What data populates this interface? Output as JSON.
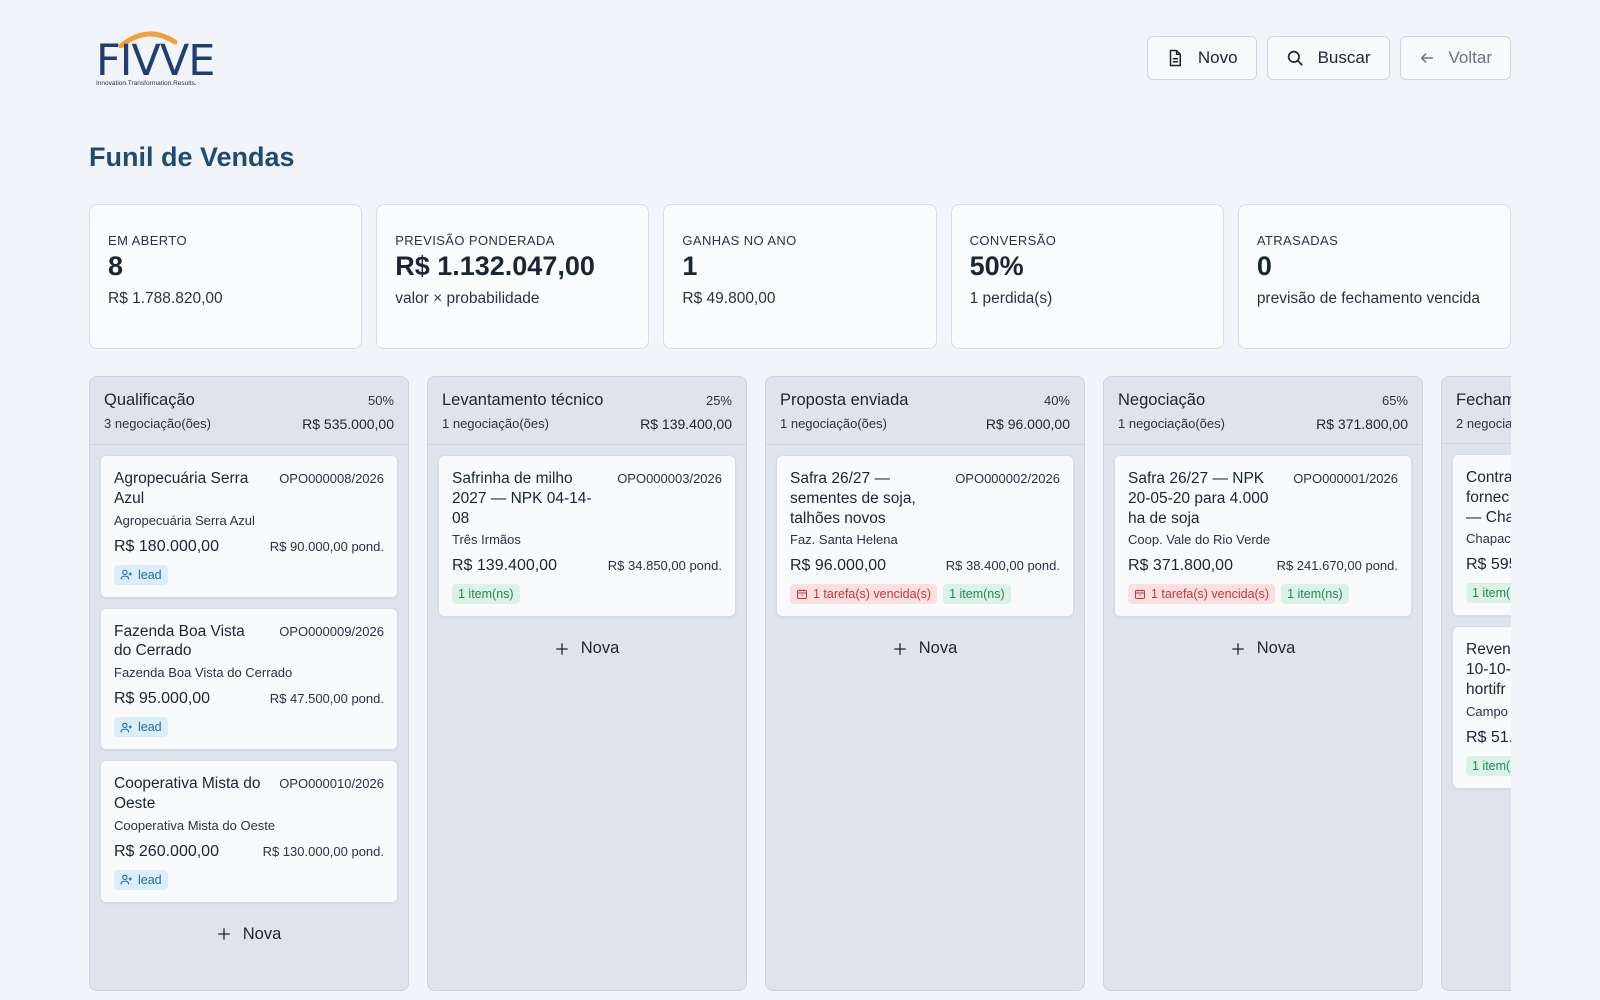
{
  "logo": {
    "word": "FIVVE",
    "tagline": "Innovation.Transformation.Results."
  },
  "toolbar": {
    "novo_label": "Novo",
    "buscar_label": "Buscar",
    "voltar_label": "Voltar"
  },
  "page": {
    "title": "Funil de Vendas"
  },
  "kpis": [
    {
      "label": "EM ABERTO",
      "value": "8",
      "sub": "R$ 1.788.820,00"
    },
    {
      "label": "PREVISÃO PONDERADA",
      "value": "R$ 1.132.047,00",
      "sub": "valor × probabilidade"
    },
    {
      "label": "GANHAS NO ANO",
      "value": "1",
      "sub": "R$ 49.800,00"
    },
    {
      "label": "CONVERSÃO",
      "value": "50%",
      "sub": "1 perdida(s)"
    },
    {
      "label": "ATRASADAS",
      "value": "0",
      "sub": "previsão de fechamento vencida"
    }
  ],
  "columns": [
    {
      "name": "Qualificação",
      "pct": "50%",
      "count": "3 negociação(ões)",
      "total": "R$ 535.000,00",
      "cards": [
        {
          "title": "Agropecuária Serra Azul",
          "code": "OPO000008/2026",
          "client": "Agropecuária Serra Azul",
          "value": "R$ 180.000,00",
          "pond": "R$ 90.000,00 pond.",
          "tag": "lead"
        },
        {
          "title": "Fazenda Boa Vista do Cerrado",
          "code": "OPO000009/2026",
          "client": "Fazenda Boa Vista do Cerrado",
          "value": "R$ 95.000,00",
          "pond": "R$ 47.500,00 pond.",
          "tag": "lead"
        },
        {
          "title": "Cooperativa Mista do Oeste",
          "code": "OPO000010/2026",
          "client": "Cooperativa Mista do Oeste",
          "value": "R$ 260.000,00",
          "pond": "R$ 130.000,00 pond.",
          "tag": "lead"
        }
      ]
    },
    {
      "name": "Levantamento técnico",
      "pct": "25%",
      "count": "1 negociação(ões)",
      "total": "R$ 139.400,00",
      "cards": [
        {
          "title": "Safrinha de milho 2027 — NPK 04-14-08",
          "code": "OPO000003/2026",
          "client": "Três Irmãos",
          "value": "R$ 139.400,00",
          "pond": "R$ 34.850,00 pond.",
          "item": "1 item(ns)"
        }
      ]
    },
    {
      "name": "Proposta enviada",
      "pct": "40%",
      "count": "1 negociação(ões)",
      "total": "R$ 96.000,00",
      "cards": [
        {
          "title": "Safra 26/27 — sementes de soja, talhões novos",
          "code": "OPO000002/2026",
          "client": "Faz. Santa Helena",
          "value": "R$ 96.000,00",
          "pond": "R$ 38.400,00 pond.",
          "late": "1 tarefa(s) vencida(s)",
          "item": "1 item(ns)"
        }
      ]
    },
    {
      "name": "Negociação",
      "pct": "65%",
      "count": "1 negociação(ões)",
      "total": "R$ 371.800,00",
      "cards": [
        {
          "title": "Safra 26/27 — NPK 20-05-20 para 4.000 ha de soja",
          "code": "OPO000001/2026",
          "client": "Coop. Vale do Rio Verde",
          "value": "R$ 371.800,00",
          "pond": "R$ 241.670,00 pond.",
          "late": "1 tarefa(s) vencida(s)",
          "item": "1 item(ns)"
        }
      ]
    },
    {
      "name": "Fecham",
      "count": "2 negocia",
      "cards": [
        {
          "title": "Contra fornec — Cha",
          "client": "Chapac",
          "value": "R$ 595",
          "item": "1 item("
        },
        {
          "title": "Reven 10-10- hortifr",
          "client": "Campo",
          "value": "R$ 51.(",
          "item": "1 item("
        }
      ]
    }
  ],
  "nova_label": "Nova",
  "colors": {
    "title": "#1f4b73",
    "logo_blue": "#1f3f72",
    "logo_arc": "#f2a13a",
    "item_green": "#1e8a55",
    "late_red": "#c9363b",
    "lead_blue": "#1f6fa6"
  },
  "icons": [
    "document-icon",
    "search-icon",
    "arrow-left-icon",
    "plus-icon",
    "user-plus-icon",
    "calendar-alert-icon"
  ]
}
